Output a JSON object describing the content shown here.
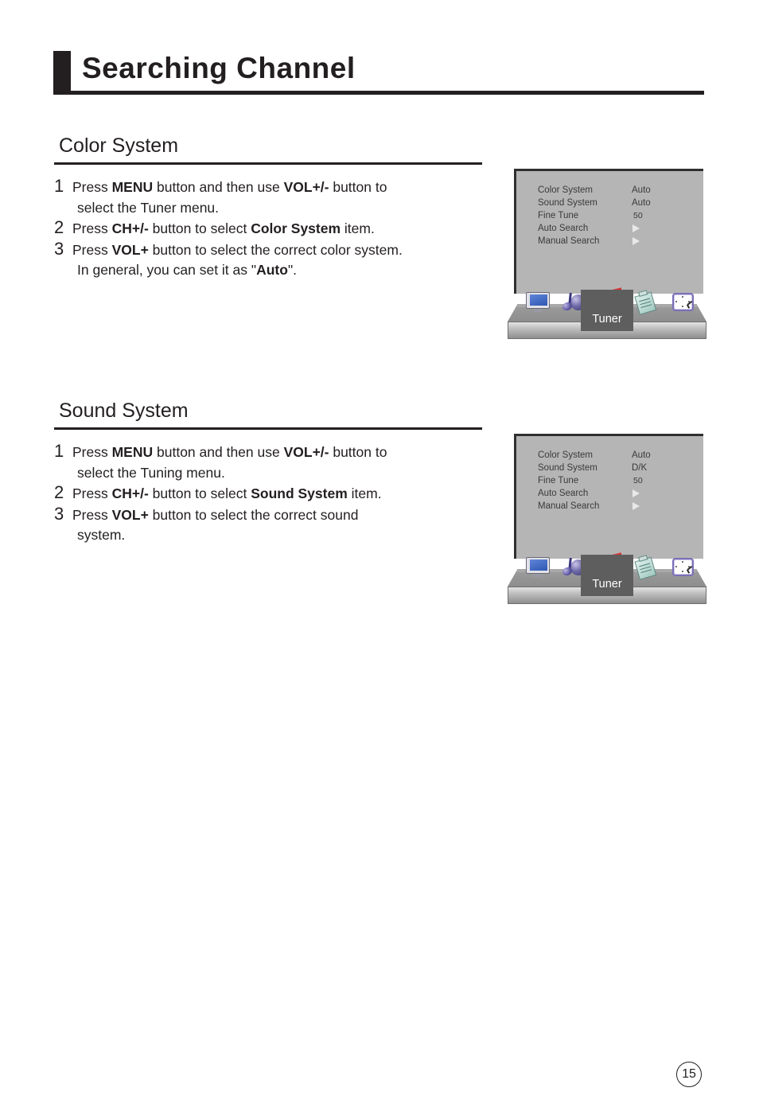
{
  "page": {
    "title": "Searching Channel",
    "number": "15"
  },
  "sections": [
    {
      "heading": "Color System",
      "steps": [
        {
          "num": "1",
          "line1_a": "Press ",
          "line1_b": "MENU",
          "line1_c": " button and then use ",
          "line1_d": "VOL+/-",
          "line1_e": " button to",
          "line2": "select the Tuner menu."
        },
        {
          "num": "2",
          "line1_a": "Press ",
          "line1_b": "CH+/-",
          "line1_c": " button to select ",
          "line1_d": "Color System",
          "line1_e": " item."
        },
        {
          "num": "3",
          "line1_a": "Press ",
          "line1_b": "VOL+",
          "line1_c": " button to select the correct color system.",
          "line2_a": "In general, you can set it as \"",
          "line2_b": "Auto",
          "line2_c": "\"."
        }
      ],
      "osd": {
        "rows": [
          {
            "label": "Color System",
            "value": "Auto",
            "kind": "text"
          },
          {
            "label": "Sound System",
            "value": "Auto",
            "kind": "text"
          },
          {
            "label": "Fine Tune",
            "value": "50",
            "kind": "num"
          },
          {
            "label": "Auto Search",
            "value": "",
            "kind": "arrow"
          },
          {
            "label": "Manual Search",
            "value": "",
            "kind": "arrow"
          }
        ],
        "tab_label": "Tuner",
        "icons": [
          "monitor-icon",
          "sound-icon",
          "tuner-icon",
          "clipboard-icon",
          "clock-icon"
        ]
      }
    },
    {
      "heading": "Sound System",
      "steps": [
        {
          "num": "1",
          "line1_a": "Press ",
          "line1_b": "MENU",
          "line1_c": " button and then use ",
          "line1_d": "VOL+/-",
          "line1_e": " button to",
          "line2": "select the Tuning menu."
        },
        {
          "num": "2",
          "line1_a": "Press ",
          "line1_b": "CH+/-",
          "line1_c": " button to select ",
          "line1_d": "Sound System",
          "line1_e": " item."
        },
        {
          "num": "3",
          "line1_a": "Press ",
          "line1_b": "VOL+",
          "line1_c": " button to select the correct sound",
          "line2_a": "system.",
          "line2_b": "",
          "line2_c": ""
        }
      ],
      "osd": {
        "rows": [
          {
            "label": "Color System",
            "value": "Auto",
            "kind": "text"
          },
          {
            "label": "Sound System",
            "value": "D/K",
            "kind": "text"
          },
          {
            "label": "Fine Tune",
            "value": "50",
            "kind": "num"
          },
          {
            "label": "Auto Search",
            "value": "",
            "kind": "arrow"
          },
          {
            "label": "Manual Search",
            "value": "",
            "kind": "arrow"
          }
        ],
        "tab_label": "Tuner",
        "icons": [
          "monitor-icon",
          "sound-icon",
          "tuner-icon",
          "clipboard-icon",
          "clock-icon"
        ]
      }
    }
  ],
  "colors": {
    "ink": "#231f20",
    "osd_bg": "#b5b5b5",
    "osd_tab": "#5e5e5e",
    "osd_text": "#3a3a3a"
  }
}
